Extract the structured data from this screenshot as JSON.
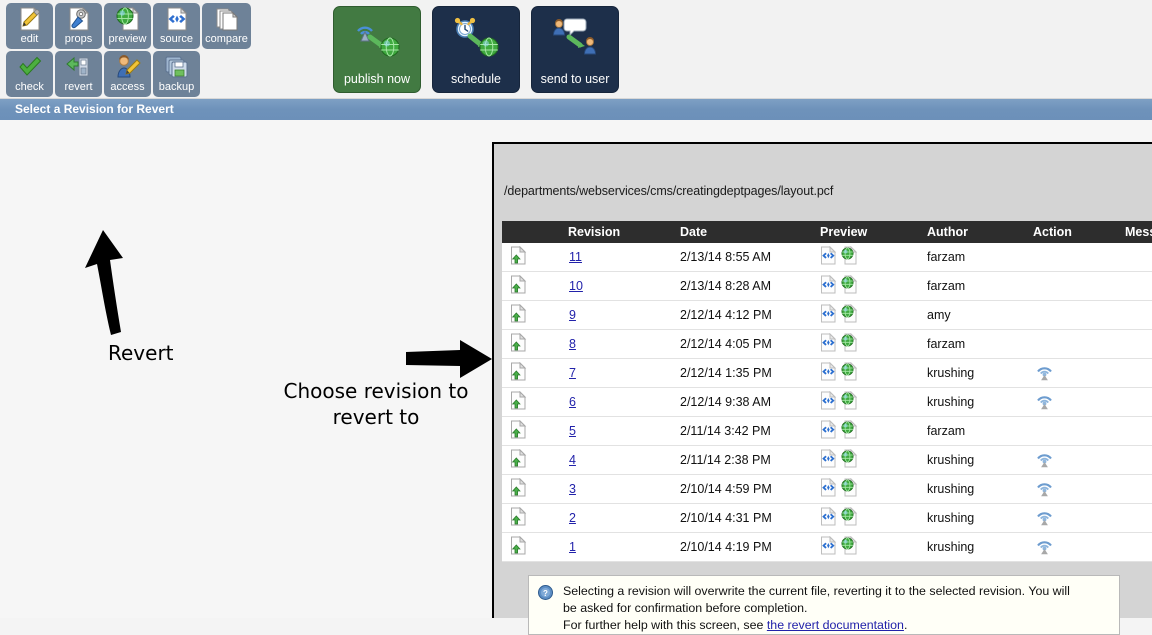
{
  "toolbar": {
    "small_buttons_row1": [
      {
        "label": "edit",
        "icon": "pencil-document-icon"
      },
      {
        "label": "props",
        "icon": "wrench-document-icon"
      },
      {
        "label": "preview",
        "icon": "globe-document-icon"
      },
      {
        "label": "source",
        "icon": "code-document-icon"
      },
      {
        "label": "compare",
        "icon": "stacked-pages-icon"
      }
    ],
    "small_buttons_row2": [
      {
        "label": "check",
        "icon": "green-check-icon"
      },
      {
        "label": "revert",
        "icon": "revert-arrow-icon"
      },
      {
        "label": "access",
        "icon": "person-pencil-icon"
      },
      {
        "label": "backup",
        "icon": "stacked-disks-icon"
      }
    ],
    "big_buttons": [
      {
        "label": "publish now",
        "icon": "broadcast-to-globe-icon",
        "color": "#427a42"
      },
      {
        "label": "schedule",
        "icon": "clock-to-globe-icon",
        "color": "#1d2f4a"
      },
      {
        "label": "send to user",
        "icon": "user-to-user-icon",
        "color": "#1d2f4a"
      }
    ]
  },
  "titlebar": {
    "text": "Select a Revision for Revert",
    "color": "#6e92ba"
  },
  "panel": {
    "path": "/departments/webservices/cms/creatingdeptpages/layout.pcf"
  },
  "table": {
    "headers": [
      "",
      "Revision",
      "Date",
      "Preview",
      "Author",
      "Action",
      "Message"
    ],
    "rows": [
      {
        "icon": "revision-file-icon",
        "revision": "11",
        "date": "2/13/14 8:55 AM",
        "preview": [
          "source-icon",
          "preview-globe-icon"
        ],
        "author": "farzam",
        "action": "",
        "message": ""
      },
      {
        "icon": "revision-file-icon",
        "revision": "10",
        "date": "2/13/14 8:28 AM",
        "preview": [
          "source-icon",
          "preview-globe-icon"
        ],
        "author": "farzam",
        "action": "",
        "message": ""
      },
      {
        "icon": "revision-file-icon",
        "revision": "9",
        "date": "2/12/14 4:12 PM",
        "preview": [
          "source-icon",
          "preview-globe-icon"
        ],
        "author": "amy",
        "action": "",
        "message": ""
      },
      {
        "icon": "revision-file-icon",
        "revision": "8",
        "date": "2/12/14 4:05 PM",
        "preview": [
          "source-icon",
          "preview-globe-icon"
        ],
        "author": "farzam",
        "action": "",
        "message": ""
      },
      {
        "icon": "revision-file-icon",
        "revision": "7",
        "date": "2/12/14 1:35 PM",
        "preview": [
          "source-icon",
          "preview-globe-icon"
        ],
        "author": "krushing",
        "action": "publish-icon",
        "message": ""
      },
      {
        "icon": "revision-file-icon",
        "revision": "6",
        "date": "2/12/14 9:38 AM",
        "preview": [
          "source-icon",
          "preview-globe-icon"
        ],
        "author": "krushing",
        "action": "publish-icon",
        "message": ""
      },
      {
        "icon": "revision-file-icon",
        "revision": "5",
        "date": "2/11/14 3:42 PM",
        "preview": [
          "source-icon",
          "preview-globe-icon"
        ],
        "author": "farzam",
        "action": "",
        "message": ""
      },
      {
        "icon": "revision-file-icon",
        "revision": "4",
        "date": "2/11/14 2:38 PM",
        "preview": [
          "source-icon",
          "preview-globe-icon"
        ],
        "author": "krushing",
        "action": "publish-icon",
        "message": ""
      },
      {
        "icon": "revision-file-icon",
        "revision": "3",
        "date": "2/10/14 4:59 PM",
        "preview": [
          "source-icon",
          "preview-globe-icon"
        ],
        "author": "krushing",
        "action": "publish-icon",
        "message": ""
      },
      {
        "icon": "revision-file-icon",
        "revision": "2",
        "date": "2/10/14 4:31 PM",
        "preview": [
          "source-icon",
          "preview-globe-icon"
        ],
        "author": "krushing",
        "action": "publish-icon",
        "message": ""
      },
      {
        "icon": "revision-file-icon",
        "revision": "1",
        "date": "2/10/14 4:19 PM",
        "preview": [
          "source-icon",
          "preview-globe-icon"
        ],
        "author": "krushing",
        "action": "publish-icon",
        "message": ""
      }
    ]
  },
  "info": {
    "icon": "help-question-icon",
    "line1": "Selecting a revision will overwrite the current file, reverting it to the selected revision. You will",
    "line2": "be asked for confirmation before completion.",
    "line3_pre": "For further help with this screen, see ",
    "link": "the revert documentation",
    "line3_post": "."
  },
  "annotations": {
    "revert_label": "Revert",
    "choose_label": "Choose revision to revert to"
  }
}
